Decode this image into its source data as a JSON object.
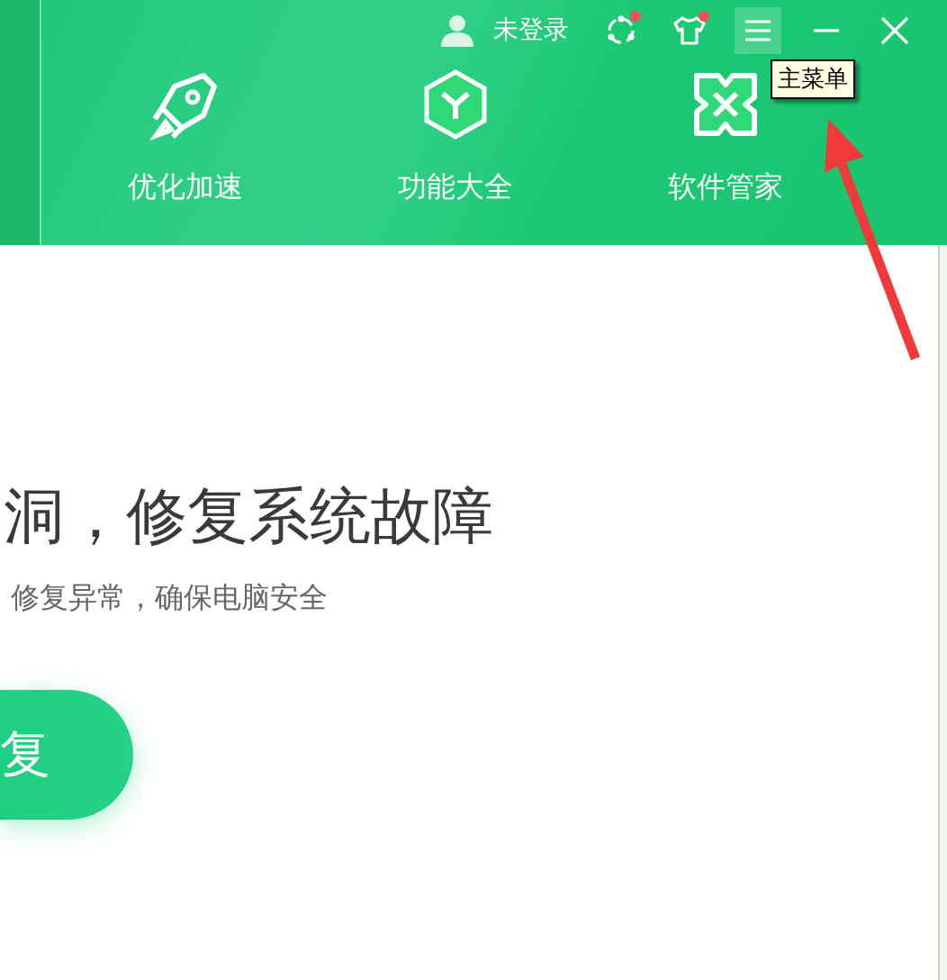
{
  "title_bar": {
    "user_label": "未登录",
    "tools": [
      {
        "kind": "share",
        "badge": true,
        "hovered": false
      },
      {
        "kind": "skin",
        "badge": true,
        "hovered": false
      },
      {
        "kind": "menu",
        "badge": false,
        "hovered": true
      },
      {
        "kind": "minimize",
        "badge": false,
        "hovered": false
      },
      {
        "kind": "close",
        "badge": false,
        "hovered": false
      }
    ],
    "tooltip": "主菜单"
  },
  "nav": [
    {
      "kind": "rocket",
      "label": "优化加速"
    },
    {
      "kind": "cube",
      "label": "功能大全"
    },
    {
      "kind": "clover",
      "label": "软件管家"
    }
  ],
  "main": {
    "heading": "洞，修复系统故障",
    "subtitle": "修复异常，确保电脑安全",
    "button": "复"
  }
}
